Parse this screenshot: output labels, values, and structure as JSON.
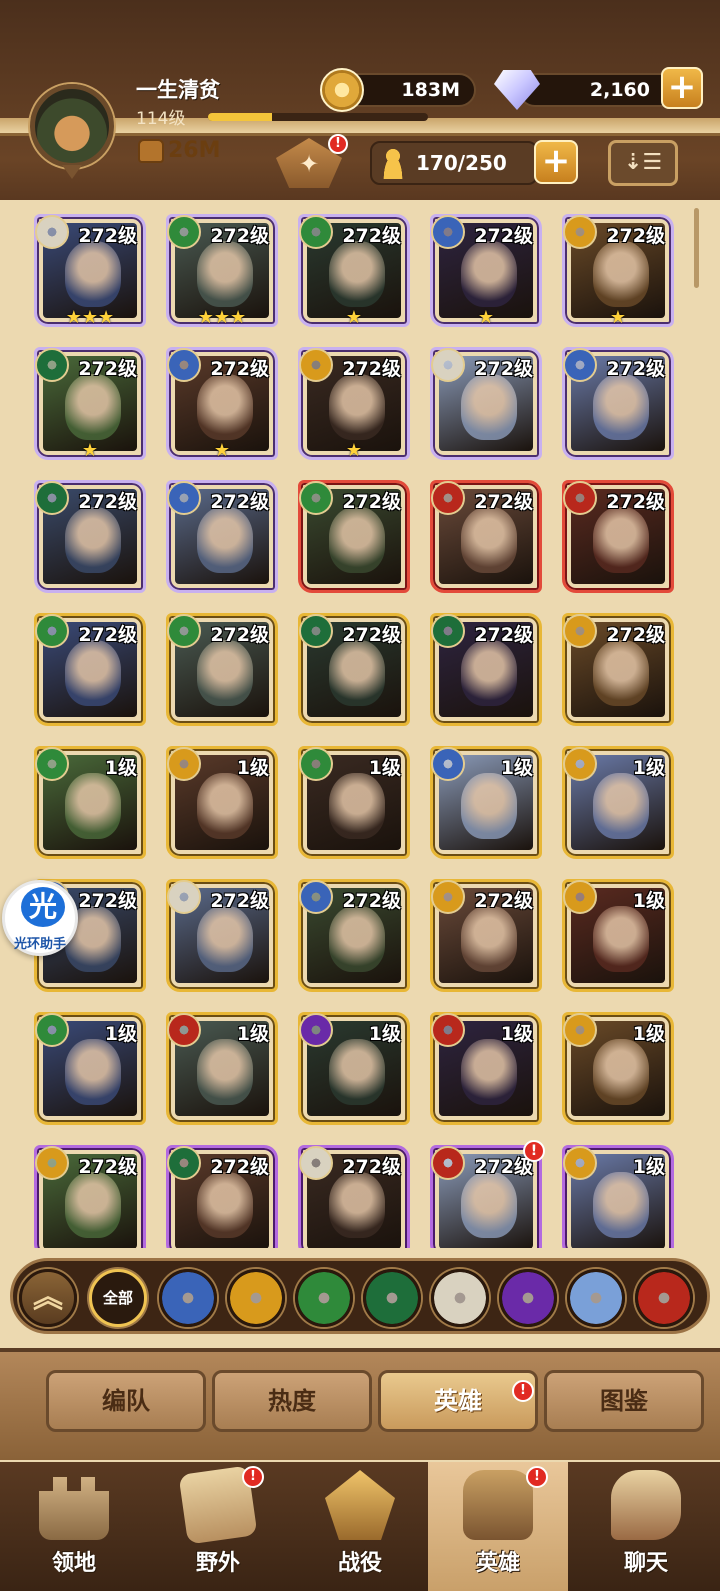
{
  "player": {
    "name": "一生清贫",
    "level": "114级",
    "xp_fraction": 0.29,
    "power": "26M"
  },
  "resources": {
    "gold": "183M",
    "gems": "2,160",
    "plus": "+"
  },
  "alert_mark": "!",
  "capacity": {
    "value": "170/250",
    "plus": "+"
  },
  "sort_glyph": "⇣☰",
  "helper": {
    "glyph": "光",
    "label": "光环助手"
  },
  "heroes": [
    {
      "level": "272级",
      "stars": "★★★",
      "faction": "celestial",
      "border": "purple"
    },
    {
      "level": "272级",
      "stars": "★★★",
      "faction": "wilder",
      "border": "purple"
    },
    {
      "level": "272级",
      "stars": "★",
      "faction": "wilder",
      "border": "purple"
    },
    {
      "level": "272级",
      "stars": "★",
      "faction": "lightbearer",
      "border": "purple"
    },
    {
      "level": "272级",
      "stars": "★",
      "faction": "mauler",
      "border": "purple"
    },
    {
      "level": "272级",
      "stars": "★",
      "faction": "graveborn",
      "border": "purple"
    },
    {
      "level": "272级",
      "stars": "★",
      "faction": "lightbearer",
      "border": "purple"
    },
    {
      "level": "272级",
      "stars": "★",
      "faction": "mauler",
      "border": "purple"
    },
    {
      "level": "272级",
      "stars": "",
      "faction": "celestial",
      "border": "purple"
    },
    {
      "level": "272级",
      "stars": "",
      "faction": "lightbearer",
      "border": "purple"
    },
    {
      "level": "272级",
      "stars": "",
      "faction": "graveborn",
      "border": "purple"
    },
    {
      "level": "272级",
      "stars": "",
      "faction": "lightbearer",
      "border": "purple"
    },
    {
      "level": "272级",
      "stars": "",
      "faction": "wilder",
      "border": "red"
    },
    {
      "level": "272级",
      "stars": "",
      "faction": "hypogean",
      "border": "red"
    },
    {
      "level": "272级",
      "stars": "",
      "faction": "hypogean",
      "border": "red"
    },
    {
      "level": "272级",
      "stars": "",
      "faction": "wilder",
      "border": "gold"
    },
    {
      "level": "272级",
      "stars": "",
      "faction": "wilder",
      "border": "gold"
    },
    {
      "level": "272级",
      "stars": "",
      "faction": "graveborn",
      "border": "gold"
    },
    {
      "level": "272级",
      "stars": "",
      "faction": "graveborn",
      "border": "gold"
    },
    {
      "level": "272级",
      "stars": "",
      "faction": "mauler",
      "border": "gold"
    },
    {
      "level": "1级",
      "stars": "",
      "faction": "wilder",
      "border": "gold"
    },
    {
      "level": "1级",
      "stars": "",
      "faction": "mauler",
      "border": "gold"
    },
    {
      "level": "1级",
      "stars": "",
      "faction": "wilder",
      "border": "gold"
    },
    {
      "level": "1级",
      "stars": "",
      "faction": "lightbearer",
      "border": "gold"
    },
    {
      "level": "1级",
      "stars": "",
      "faction": "mauler",
      "border": "gold"
    },
    {
      "level": "272级",
      "stars": "",
      "faction": "lightbearer",
      "border": "gold"
    },
    {
      "level": "272级",
      "stars": "",
      "faction": "celestial",
      "border": "gold"
    },
    {
      "level": "272级",
      "stars": "",
      "faction": "lightbearer",
      "border": "gold"
    },
    {
      "level": "272级",
      "stars": "",
      "faction": "mauler",
      "border": "gold"
    },
    {
      "level": "1级",
      "stars": "",
      "faction": "mauler",
      "border": "gold"
    },
    {
      "level": "1级",
      "stars": "",
      "faction": "wilder",
      "border": "gold"
    },
    {
      "level": "1级",
      "stars": "",
      "faction": "hypogean",
      "border": "gold"
    },
    {
      "level": "1级",
      "stars": "",
      "faction": "dimensional",
      "border": "gold"
    },
    {
      "level": "1级",
      "stars": "",
      "faction": "hypogean",
      "border": "gold"
    },
    {
      "level": "1级",
      "stars": "",
      "faction": "mauler",
      "border": "gold"
    },
    {
      "level": "272级",
      "stars": "",
      "faction": "mauler",
      "border": "deep"
    },
    {
      "level": "272级",
      "stars": "",
      "faction": "graveborn",
      "border": "deep"
    },
    {
      "level": "272级",
      "stars": "",
      "faction": "celestial",
      "border": "deep"
    },
    {
      "level": "272级",
      "stars": "",
      "faction": "hypogean",
      "border": "deep",
      "alert": "!"
    },
    {
      "level": "1级",
      "stars": "",
      "faction": "mauler",
      "border": "deep"
    }
  ],
  "filters": {
    "up": "︽",
    "all": "全部",
    "items": [
      "lightbearer",
      "mauler",
      "wilder",
      "graveborn",
      "celestial",
      "dimensional",
      "elemental",
      "hypogean"
    ]
  },
  "tabs": [
    "编队",
    "热度",
    "英雄",
    "图鉴"
  ],
  "nav": [
    "领地",
    "野外",
    "战役",
    "英雄",
    "聊天"
  ],
  "colors": {
    "lightbearer": "#3a64b8",
    "mauler": "#d89a1c",
    "wilder": "#2f8a3a",
    "graveborn": "#1e6e3a",
    "celestial": "#d9d2c0",
    "dimensional": "#6a2aa8",
    "elemental": "#7aa0d8",
    "hypogean": "#b8281c"
  }
}
